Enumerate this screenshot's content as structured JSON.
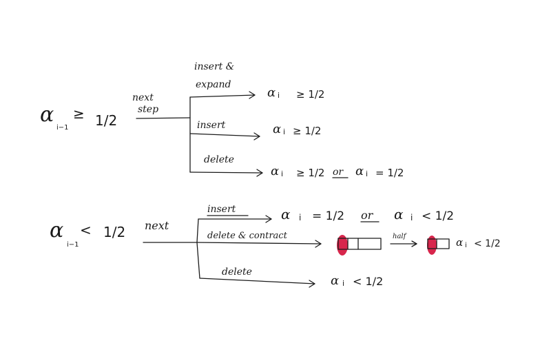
{
  "top_tree": {
    "condition": {
      "symbol": "α",
      "subscript": "i−1",
      "relation": "≥",
      "value": "1/2"
    },
    "trigger_label_line1": "next",
    "trigger_label_line2": "step",
    "branches": [
      {
        "op_line1": "insert &",
        "op_line2": "expand",
        "result": "α",
        "result_sub": "i",
        "result_rel": "≥ 1/2"
      },
      {
        "op": "insert",
        "result": "α",
        "result_sub": "i",
        "result_rel": "≥ 1/2"
      },
      {
        "op": "delete",
        "result": "α",
        "result_sub": "i",
        "result_rel": "≥ 1/2",
        "or_word": "or",
        "alt": "α",
        "alt_sub": "i",
        "alt_rel": "= 1/2"
      }
    ]
  },
  "bottom_tree": {
    "condition": {
      "symbol": "α",
      "subscript": "i−1",
      "relation": "<",
      "value": "1/2"
    },
    "trigger_label": "next",
    "branches": [
      {
        "op": "insert",
        "result": "α",
        "result_sub": "i",
        "result_rel": "= 1/2",
        "or_word": "or",
        "alt": "α",
        "alt_sub": "i",
        "alt_rel": "< 1/2"
      },
      {
        "op": "delete & contract",
        "half_label": "half",
        "after": "α",
        "after_sub": "i",
        "after_rel": "< 1/2"
      },
      {
        "op": "delete",
        "result": "α",
        "result_sub": "i",
        "result_rel": "< 1/2"
      }
    ]
  },
  "colors": {
    "ink": "#1a1a1a",
    "highlight": "#d7264c"
  }
}
